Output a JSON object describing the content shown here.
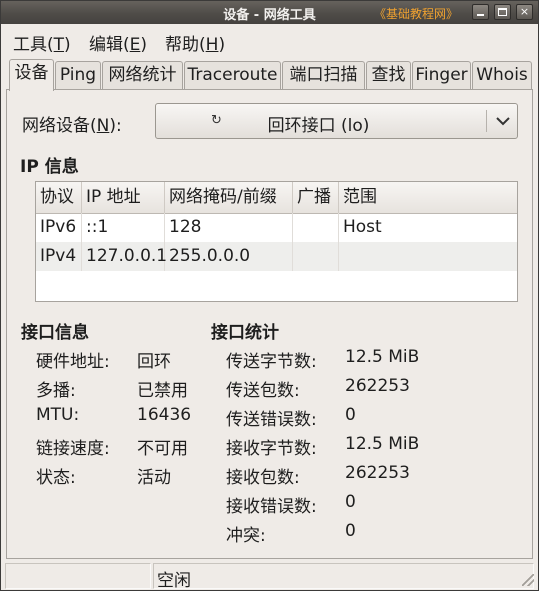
{
  "window": {
    "title": "设备 - 网络工具",
    "watermark": "《基础教程网》",
    "buttons": {
      "minimize": "minimize",
      "maximize": "maximize",
      "close": "×"
    }
  },
  "menubar": [
    {
      "label": "工具(",
      "mnemonic": "T",
      "tail": ")"
    },
    {
      "label": "编辑(",
      "mnemonic": "E",
      "tail": ")"
    },
    {
      "label": "帮助(",
      "mnemonic": "H",
      "tail": ")"
    }
  ],
  "tabs": [
    "设备",
    "Ping",
    "网络统计",
    "Traceroute",
    "端口扫描",
    "查找",
    "Finger",
    "Whois"
  ],
  "device": {
    "label_prefix": "网络设备(",
    "label_mnemonic": "N",
    "label_suffix": "):",
    "selected": "回环接口 (lo)",
    "icon": "↻"
  },
  "ip_info": {
    "title": "IP 信息",
    "columns": [
      "协议",
      "IP 地址",
      "网络掩码/前缀",
      "广播",
      "范围"
    ],
    "rows": [
      [
        "IPv6",
        "::1",
        "128",
        "",
        "Host"
      ],
      [
        "IPv4",
        "127.0.0.1",
        "255.0.0.0",
        "",
        ""
      ]
    ]
  },
  "interface_info": {
    "title": "接口信息",
    "items": [
      {
        "label": "硬件地址:",
        "value": "回环"
      },
      {
        "label": "多播:",
        "value": "已禁用"
      },
      {
        "label": "MTU:",
        "value": "16436"
      },
      {
        "label": "链接速度:",
        "value": "不可用"
      },
      {
        "label": "状态:",
        "value": "活动"
      }
    ]
  },
  "interface_stats": {
    "title": "接口统计",
    "items": [
      {
        "label": "传送字节数:",
        "value": "12.5 MiB"
      },
      {
        "label": "传送包数:",
        "value": "262253"
      },
      {
        "label": "传送错误数:",
        "value": "0"
      },
      {
        "label": "接收字节数:",
        "value": "12.5 MiB"
      },
      {
        "label": "接收包数:",
        "value": "262253"
      },
      {
        "label": "接收错误数:",
        "value": "0"
      },
      {
        "label": "冲突:",
        "value": "0"
      }
    ]
  },
  "statusbar": {
    "text": "空闲"
  }
}
